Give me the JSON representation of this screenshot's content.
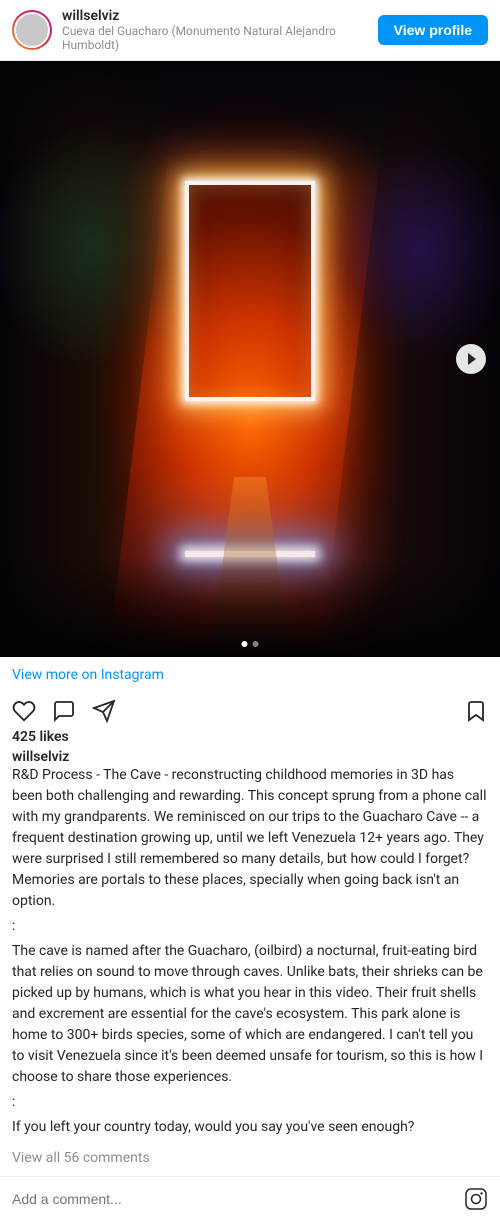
{
  "header": {
    "username": "willselviz",
    "location": "Cueva del Guacharo (Monumento Natural Alejandro Humboldt)",
    "view_profile_label": "View profile"
  },
  "post": {
    "view_more_label": "View more on Instagram",
    "likes_label": "425 likes",
    "caption_username": "willselviz",
    "caption": "R&D Process - The Cave - reconstructing childhood memories in 3D has been both challenging and rewarding. This concept sprung from a phone call with my grandparents. We reminisced on our trips to the Guacharo Cave -- a frequent destination growing up, until we left Venezuela 12+ years ago. They were surprised I still remembered so many details, but how could I forget? Memories are portals to these places, specially when going back isn't an option.\n:\nThe cave is named after the Guacharo, (oilbird) a nocturnal, fruit-eating bird that relies on sound to move through caves. Unlike bats, their shrieks can be picked up by humans, which is what you hear in this video. Their fruit shells and excrement are essential for the cave's ecosystem. This park alone is home to 300+ birds species, some of which are endangered. I can't tell you to visit Venezuela since it's been deemed unsafe for tourism, so this is how I choose to share those experiences.\n:\nIf you left your country today, would you say you've seen enough?",
    "view_comments_label": "View all 56 comments",
    "add_comment_placeholder": "Add a comment...",
    "dots": [
      {
        "active": true
      },
      {
        "active": false
      }
    ]
  }
}
